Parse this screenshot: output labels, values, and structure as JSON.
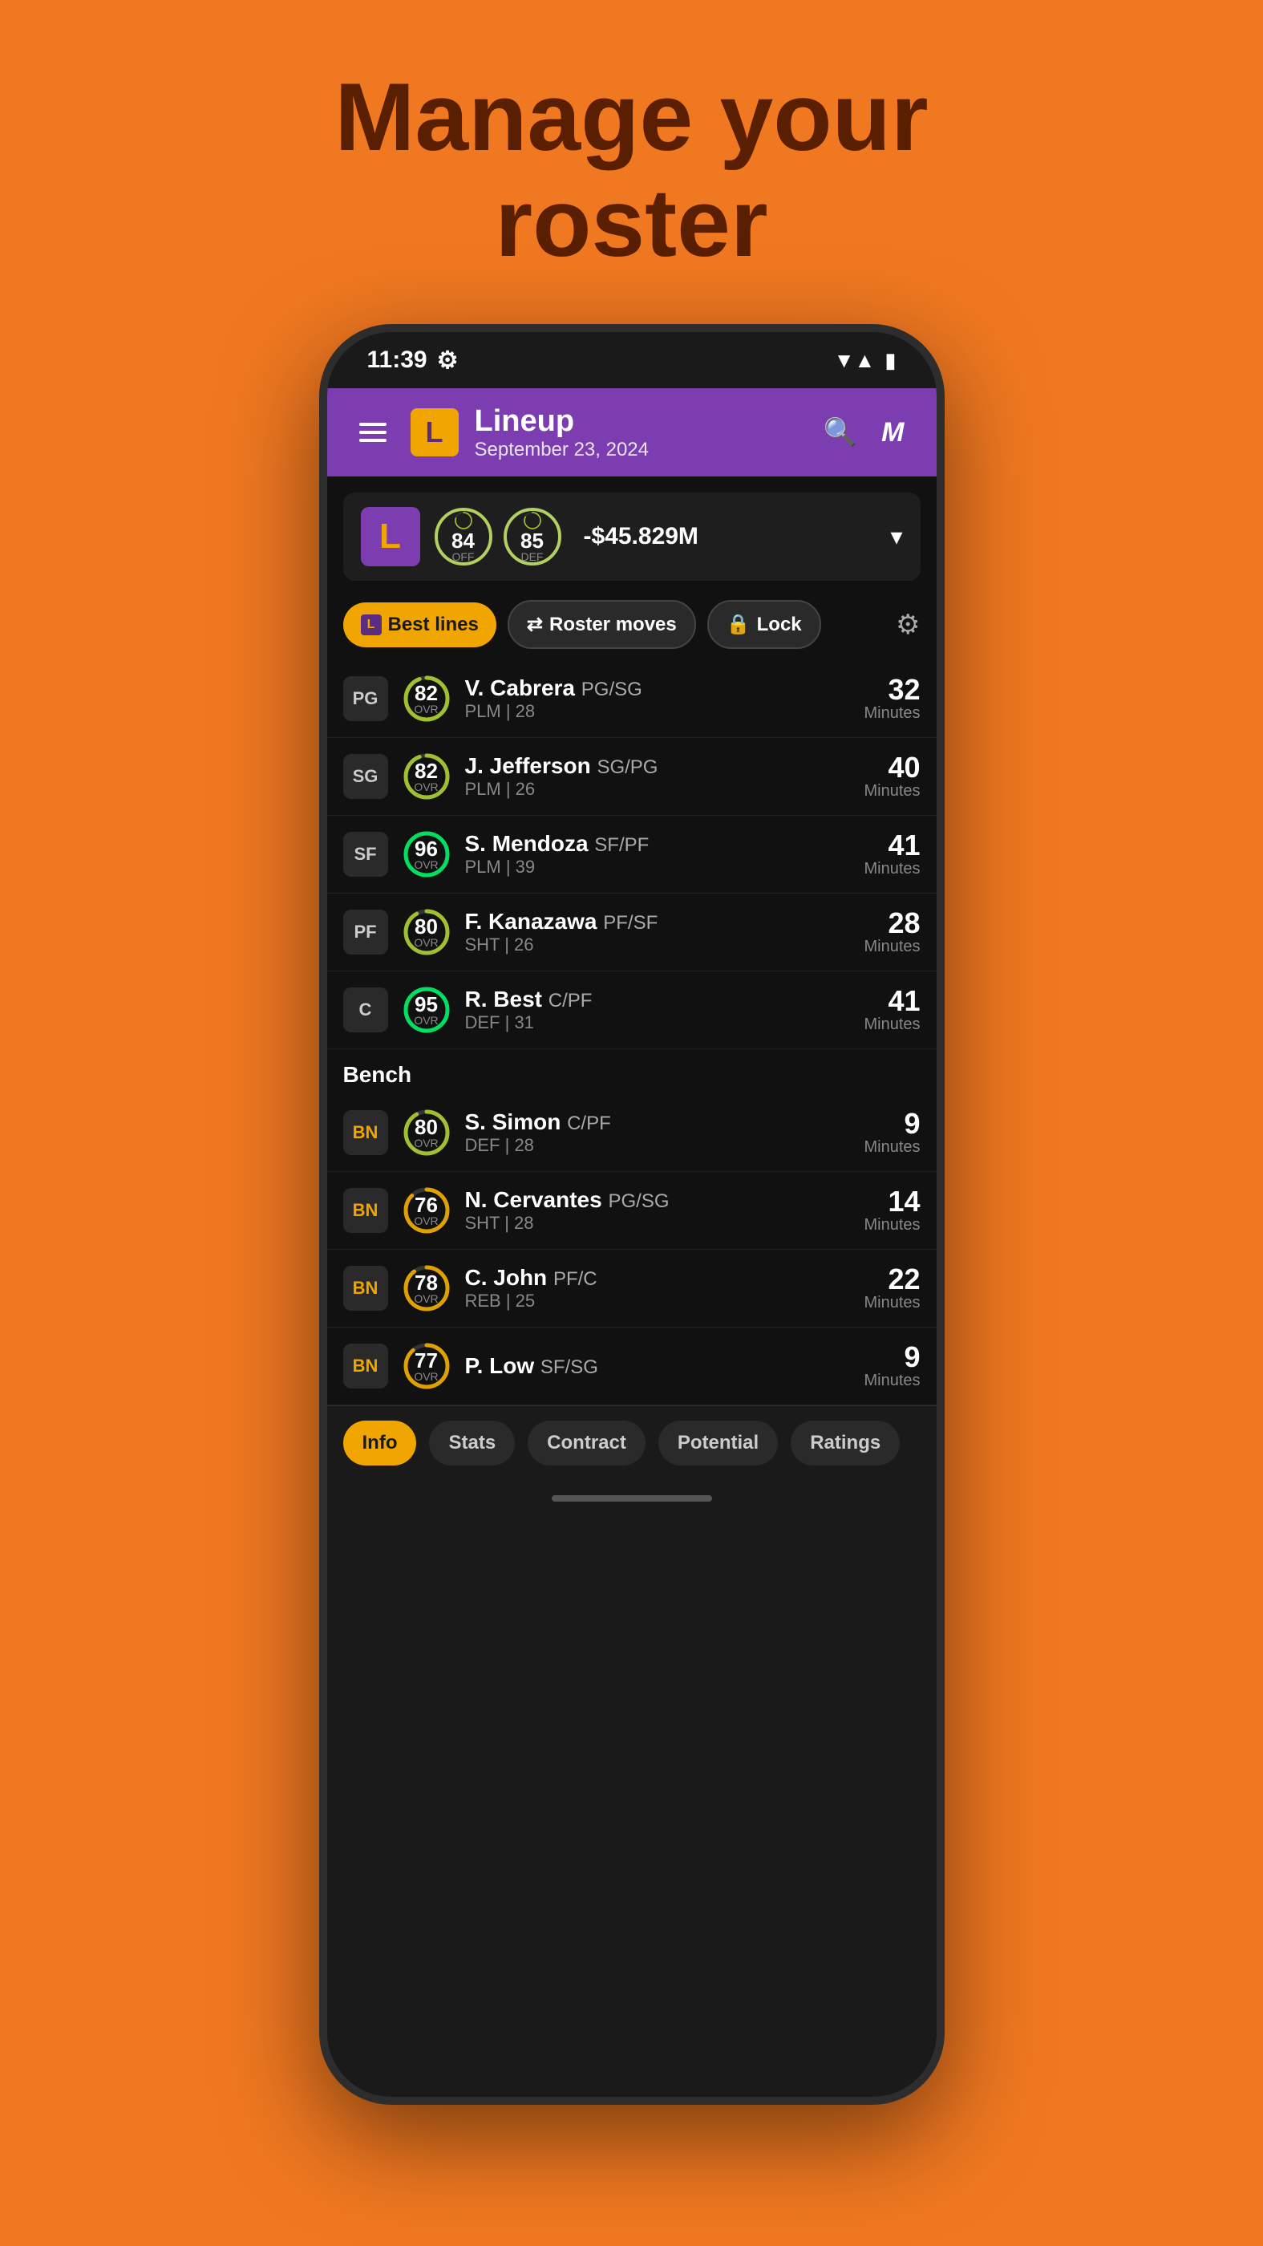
{
  "page": {
    "title_line1": "Manage your",
    "title_line2": "roster",
    "background_color": "#F07820"
  },
  "status_bar": {
    "time": "11:39",
    "settings_icon": "⚙",
    "wifi_icon": "▼",
    "signal_icon": "▲",
    "battery_icon": "▮"
  },
  "header": {
    "team_logo": "L",
    "title": "Lineup",
    "subtitle": "September 23, 2024",
    "search_icon": "🔍",
    "profile_letter": "M"
  },
  "team_summary": {
    "logo": "L",
    "offense_rating": 84,
    "offense_label": "OFF",
    "defense_rating": 85,
    "defense_label": "DEF",
    "salary": "-$45.829M"
  },
  "action_buttons": {
    "best_lines": "Best lines",
    "roster_moves": "Roster moves",
    "lock": "Lock",
    "settings_icon": "⚙"
  },
  "starters": [
    {
      "position": "PG",
      "ovr": 82,
      "name": "V. Cabrera",
      "position_detail": "PG/SG",
      "meta": "PLM | 28",
      "minutes": 32,
      "ring_color": "#a0c030"
    },
    {
      "position": "SG",
      "ovr": 82,
      "name": "J. Jefferson",
      "position_detail": "SG/PG",
      "meta": "PLM | 26",
      "minutes": 40,
      "ring_color": "#a0c030"
    },
    {
      "position": "SF",
      "ovr": 96,
      "name": "S. Mendoza",
      "position_detail": "SF/PF",
      "meta": "PLM | 39",
      "minutes": 41,
      "ring_color": "#00e060"
    },
    {
      "position": "PF",
      "ovr": 80,
      "name": "F. Kanazawa",
      "position_detail": "PF/SF",
      "meta": "SHT | 26",
      "minutes": 28,
      "ring_color": "#a0c030"
    },
    {
      "position": "C",
      "ovr": 95,
      "name": "R. Best",
      "position_detail": "C/PF",
      "meta": "DEF | 31",
      "minutes": 41,
      "ring_color": "#00e060"
    }
  ],
  "bench_label": "Bench",
  "bench": [
    {
      "position": "BN",
      "ovr": 80,
      "name": "S. Simon",
      "position_detail": "C/PF",
      "meta": "DEF | 28",
      "minutes": 9,
      "ring_color": "#a0c030"
    },
    {
      "position": "BN",
      "ovr": 76,
      "name": "N. Cervantes",
      "position_detail": "PG/SG",
      "meta": "SHT | 28",
      "minutes": 14,
      "ring_color": "#e0a000"
    },
    {
      "position": "BN",
      "ovr": 78,
      "name": "C. John",
      "position_detail": "PF/C",
      "meta": "REB | 25",
      "minutes": 22,
      "ring_color": "#e0a000"
    },
    {
      "position": "BN",
      "ovr": 77,
      "name": "P. Low",
      "position_detail": "SF/SG",
      "meta": "",
      "minutes": 9,
      "ring_color": "#e0a000"
    }
  ],
  "bottom_tabs": [
    {
      "label": "Info",
      "active": true
    },
    {
      "label": "Stats",
      "active": false
    },
    {
      "label": "Contract",
      "active": false
    },
    {
      "label": "Potential",
      "active": false
    },
    {
      "label": "Ratings",
      "active": false
    }
  ]
}
